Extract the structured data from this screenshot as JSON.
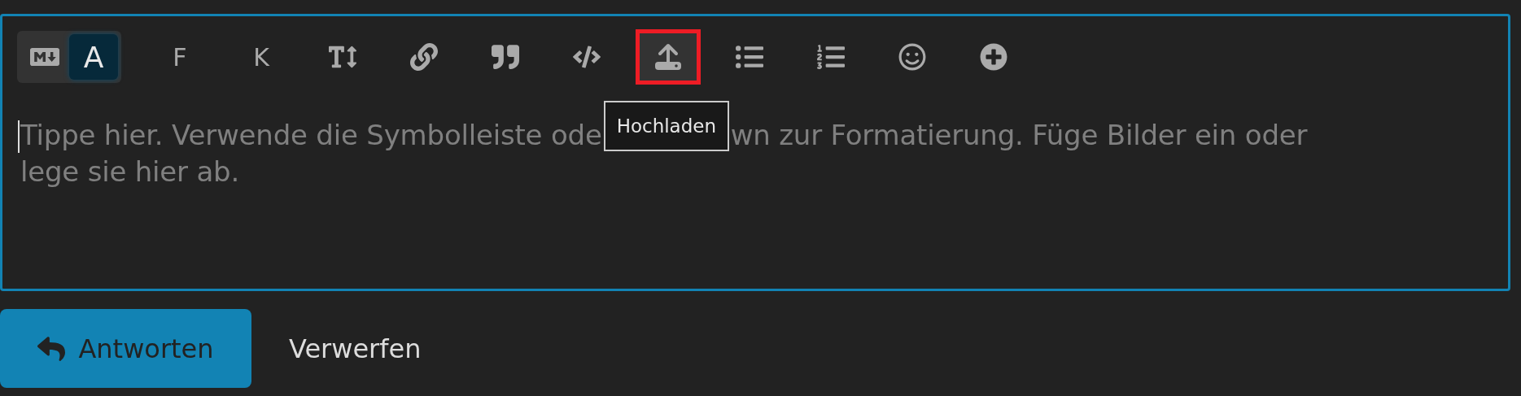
{
  "editor": {
    "focused": true,
    "mode_toggle": [
      {
        "kind": "icon",
        "selected": false
      },
      {
        "kind": "text",
        "label": "A",
        "selected": true
      }
    ],
    "toolbar": [
      {
        "kind": "text",
        "label": "F",
        "hovered": false
      },
      {
        "kind": "text",
        "label": "K",
        "hovered": false
      },
      {
        "kind": "icon",
        "hovered": false
      },
      {
        "kind": "icon",
        "hovered": false
      },
      {
        "kind": "icon",
        "hovered": false
      },
      {
        "kind": "icon",
        "hovered": false
      },
      {
        "kind": "icon",
        "hovered": true
      },
      {
        "kind": "icon",
        "hovered": false
      },
      {
        "kind": "icon",
        "hovered": false
      },
      {
        "kind": "icon",
        "hovered": false
      },
      {
        "kind": "icon",
        "hovered": false
      }
    ],
    "tooltip": "Hochladen",
    "placeholder": [
      "Tippe hier. Verwende die Symbolleiste ode",
      "wn zur Formatierung. Füge Bilder ein oder",
      "lege sie hier ab."
    ]
  },
  "actions": [
    {
      "kind": "primary",
      "label": "Antworten"
    },
    {
      "kind": "plain",
      "label": "Verwerfen"
    }
  ]
}
